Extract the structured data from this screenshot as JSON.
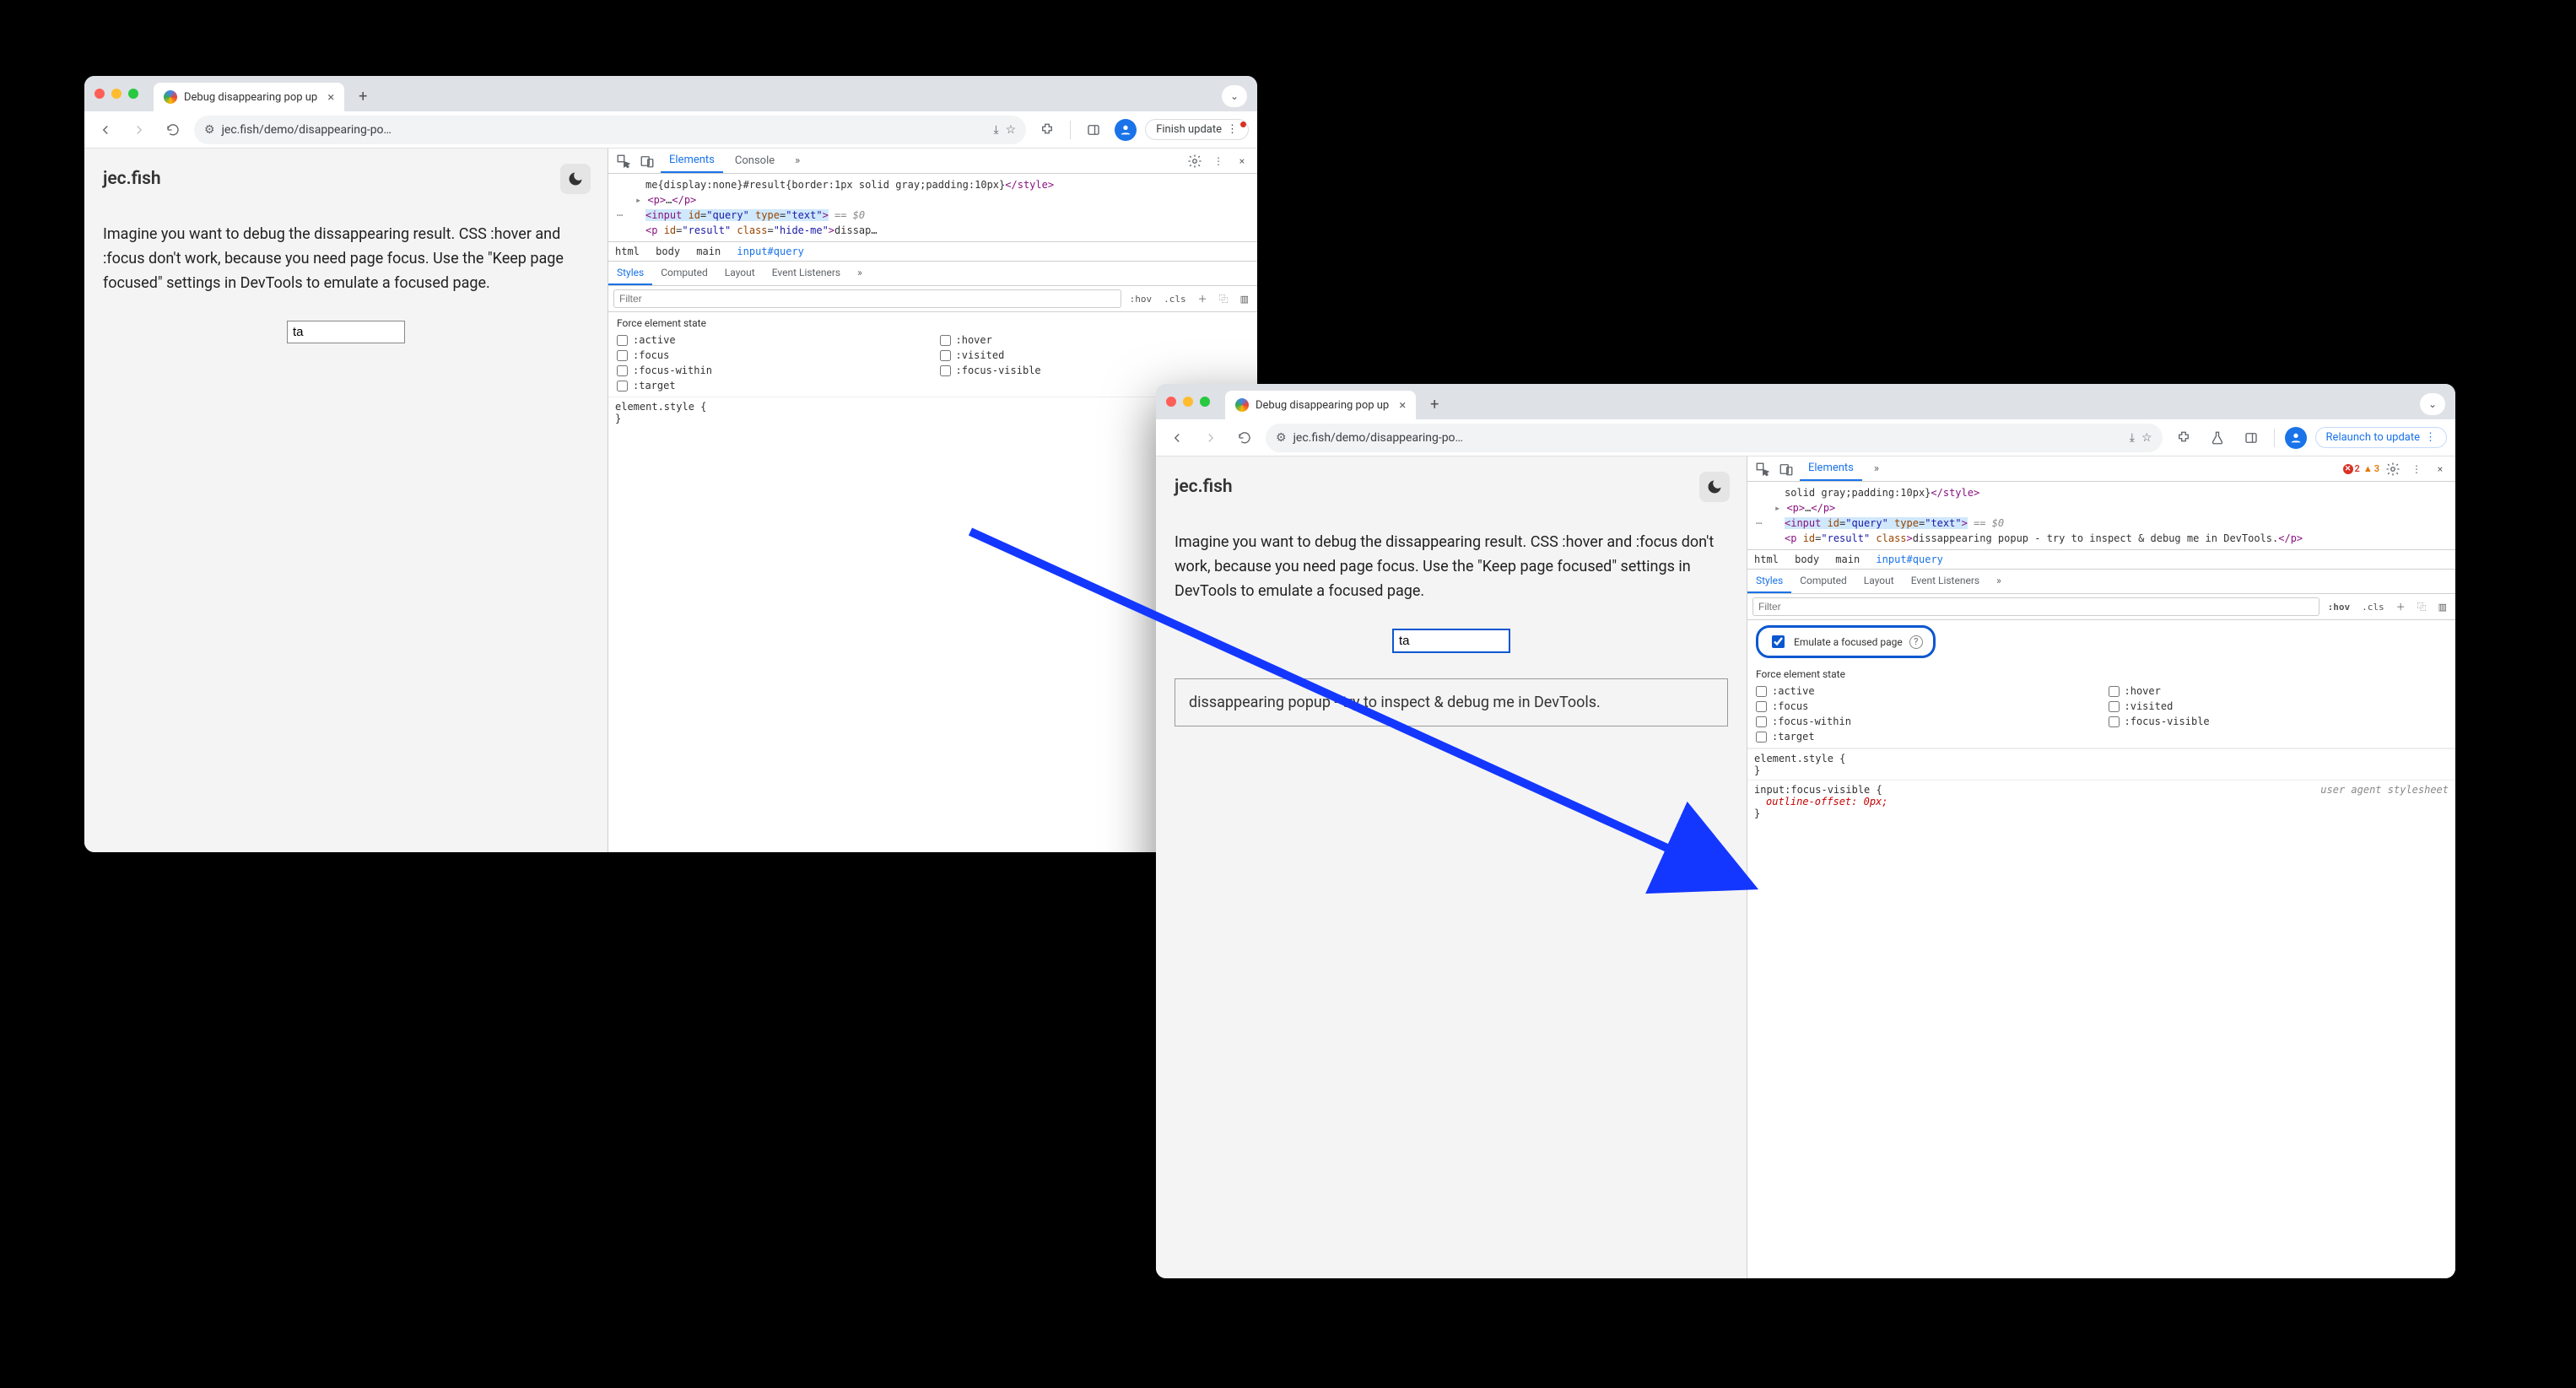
{
  "windowA": {
    "tab_title": "Debug disappearing pop up",
    "url": "jec.fish/demo/disappearing-po…",
    "update_label": "Finish update",
    "page": {
      "heading": "jec.fish",
      "desc": "Imagine you want to debug the dissappearing result. CSS :hover and :focus don't work, because you need page focus. Use the \"Keep page focused\" settings in DevTools to emulate a focused page.",
      "query_value": "ta"
    },
    "devtools": {
      "top_tabs": {
        "elements": "Elements",
        "console": "Console"
      },
      "code_line1": "me{display:none}#result{border:1px solid gray;padding:10px}",
      "code_style_close": "</style>",
      "p_open": "<p>",
      "p_ellipsis": "…",
      "p_close": "</p>",
      "input_html": "<input id=\"query\" type=\"text\">",
      "eq0": " == $0",
      "p_result_open": "<p id=\"result\" class=\"hide-me\">",
      "p_result_text": "dissap…",
      "crumbs": [
        "html",
        "body",
        "main",
        "input#query"
      ],
      "styles_tabs": [
        "Styles",
        "Computed",
        "Layout",
        "Event Listeners"
      ],
      "filter_placeholder": "Filter",
      "hov_label": ":hov",
      "cls_label": ".cls",
      "force_label": "Force element state",
      "states": [
        ":active",
        ":hover",
        ":focus",
        ":visited",
        ":focus-within",
        ":focus-visible",
        ":target"
      ],
      "rule_open": "element.style {",
      "rule_close": "}"
    }
  },
  "windowB": {
    "tab_title": "Debug disappearing pop up",
    "url": "jec.fish/demo/disappearing-po…",
    "update_label": "Relaunch to update",
    "errors": "2",
    "warnings": "3",
    "page": {
      "heading": "jec.fish",
      "desc": "Imagine you want to debug the dissappearing result. CSS :hover and :focus don't work, because you need page focus. Use the \"Keep page focused\" settings in DevTools to emulate a focused page.",
      "query_value": "ta",
      "result_text": "dissappearing popup - try to inspect & debug me in DevTools."
    },
    "devtools": {
      "top_tabs": {
        "elements": "Elements"
      },
      "code_line1": "solid gray;padding:10px}",
      "code_style_close": "</style>",
      "p_open": "<p>",
      "p_ellipsis": "…",
      "p_close": "</p>",
      "input_html": "<input id=\"query\" type=\"text\">",
      "eq0": " == $0",
      "p_result_open": "<p id=\"result\" class>",
      "p_result_text": "dissappearing popup - try to inspect & debug me in DevTools.",
      "p_result_close": "</p>",
      "crumbs": [
        "html",
        "body",
        "main",
        "input#query"
      ],
      "styles_tabs": [
        "Styles",
        "Computed",
        "Layout",
        "Event Listeners"
      ],
      "filter_placeholder": "Filter",
      "hov_label": ":hov",
      "cls_label": ".cls",
      "emulate_label": "Emulate a focused page",
      "force_label": "Force element state",
      "states": [
        ":active",
        ":hover",
        ":focus",
        ":visited",
        ":focus-within",
        ":focus-visible",
        ":target"
      ],
      "rule1_open": "element.style {",
      "rule1_close": "}",
      "rule2_sel": "input:focus-visible {",
      "rule2_prop": "outline-offset: 0px;",
      "rule2_close": "}",
      "uas": "user agent stylesheet"
    }
  }
}
